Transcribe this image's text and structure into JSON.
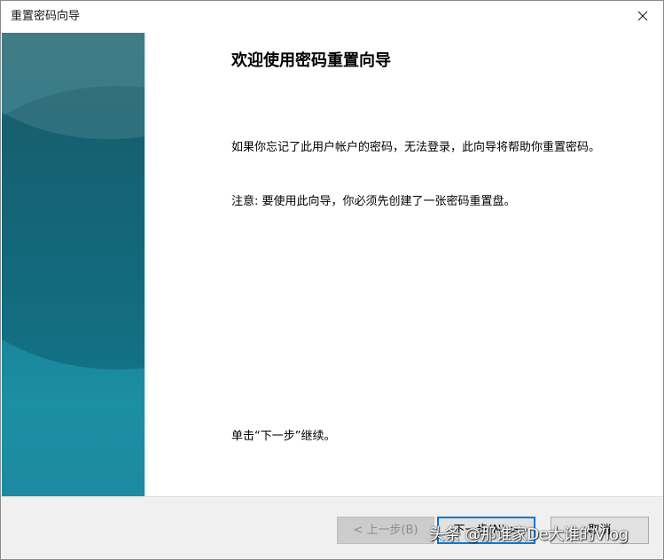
{
  "window": {
    "title": "重置密码向导"
  },
  "content": {
    "heading": "欢迎使用密码重置向导",
    "paragraph1": "如果你忘记了此用户帐户的密码，无法登录，此向导将帮助你重置密码。",
    "paragraph2": "注意: 要使用此向导，你必须先创建了一张密码重置盘。",
    "paragraph3": "单击“下一步”继续。"
  },
  "footer": {
    "back_label": "< 上一步(B)",
    "next_label": "下一步(N) >",
    "cancel_label": "取消"
  },
  "watermark": {
    "text": "头条 @那谁家De大谁的Vlog"
  },
  "colors": {
    "accent": "#0078d7",
    "side_panel": "#1e7f92"
  },
  "icons": {
    "close": "close-icon"
  }
}
